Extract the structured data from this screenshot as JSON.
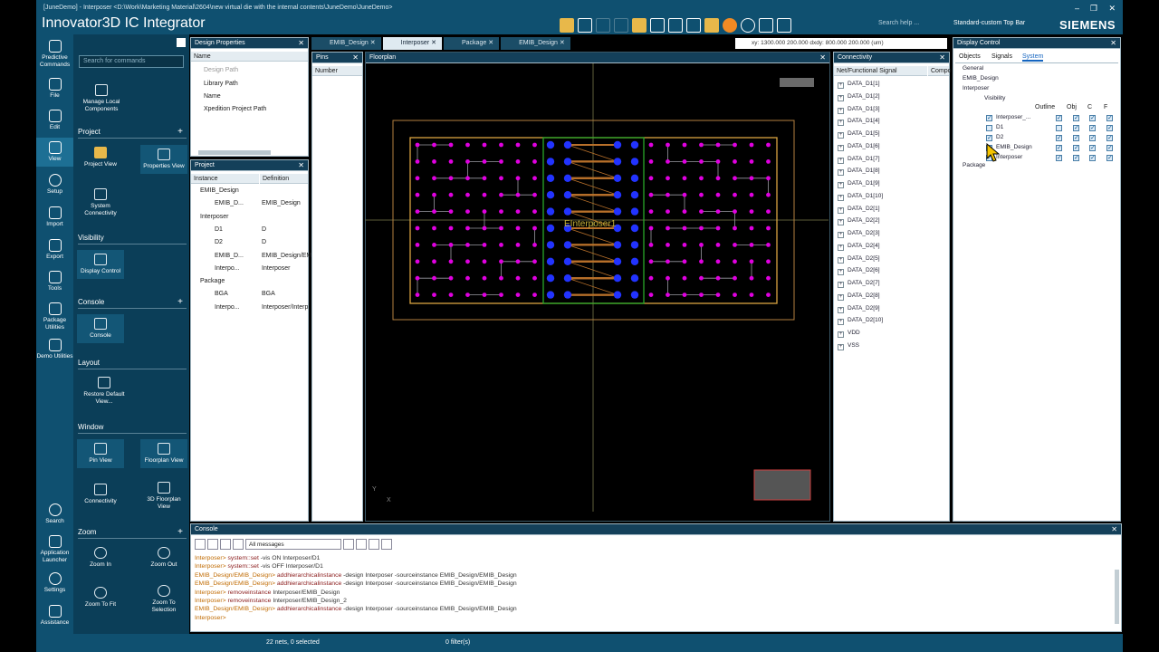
{
  "window": {
    "path": "[JuneDemo] - Interposer <D:\\Work\\Marketing Material\\2604\\new virtual die with the internal contents\\JuneDemo\\JuneDemo>",
    "app_title": "Innovator3D IC Integrator",
    "brand": "SIEMENS",
    "search_placeholder": "Search help ...",
    "topbar_select": "Standard-custom Top Bar",
    "controls": [
      "–",
      "❐",
      "✕"
    ]
  },
  "left_nav": [
    {
      "label": "Predictive Commands",
      "icon": "predictive-icon"
    },
    {
      "label": "File",
      "icon": "file-icon"
    },
    {
      "label": "Edit",
      "icon": "edit-icon"
    },
    {
      "label": "View",
      "icon": "view-icon"
    },
    {
      "label": "Setup",
      "icon": "gear-icon"
    },
    {
      "label": "Import",
      "icon": "import-icon"
    },
    {
      "label": "Export",
      "icon": "export-icon"
    },
    {
      "label": "Tools",
      "icon": "tools-icon"
    },
    {
      "label": "Package Utilities",
      "icon": "package-icon"
    },
    {
      "label": "Demo Utilities",
      "icon": "demo-icon"
    },
    {
      "label": "Search",
      "icon": "search-icon"
    },
    {
      "label": "Application Launcher",
      "icon": "launcher-icon"
    },
    {
      "label": "Settings",
      "icon": "settings-icon"
    },
    {
      "label": "Assistance",
      "icon": "assistance-icon"
    }
  ],
  "tool_panel": {
    "search_placeholder": "Search for commands",
    "manage_local": "Manage Local Components",
    "sections": {
      "project": "Project",
      "visibility": "Visibility",
      "console": "Console",
      "layout": "Layout",
      "window": "Window",
      "zoom": "Zoom"
    },
    "buttons": {
      "project_view": "Project View",
      "properties_view": "Properties View",
      "system_connectivity": "System Connectivity",
      "display_control": "Display Control",
      "console": "Console",
      "restore_default": "Restore Default View...",
      "pin_view": "Pin View",
      "floorplan_view": "Floorplan View",
      "connectivity": "Connectivity",
      "floorplan_3d": "3D Floorplan View",
      "zoom_in": "Zoom In",
      "zoom_out": "Zoom Out",
      "zoom_fit": "Zoom To Fit",
      "zoom_selection": "Zoom To Selection"
    }
  },
  "design_properties": {
    "title": "Design Properties",
    "col_name": "Name",
    "rows": [
      "Design Path",
      "Library Path",
      "Name",
      "Xpedition Project Path"
    ]
  },
  "project_panel": {
    "title": "Project",
    "col_instance": "Instance",
    "col_definition": "Definition",
    "rows": [
      {
        "instance": "EMIB_Design",
        "definition": ""
      },
      {
        "instance": "EMIB_D...",
        "definition": "EMIB_Design"
      },
      {
        "instance": "Interposer",
        "definition": ""
      },
      {
        "instance": "D1",
        "definition": "D"
      },
      {
        "instance": "D2",
        "definition": "D"
      },
      {
        "instance": "EMIB_D...",
        "definition": "EMIB_Design/EM"
      },
      {
        "instance": "Interpo...",
        "definition": "Interposer"
      },
      {
        "instance": "Package",
        "definition": ""
      },
      {
        "instance": "BGA",
        "definition": "BGA"
      },
      {
        "instance": "Interpo...",
        "definition": "Interposer/Interp"
      }
    ]
  },
  "tabs": [
    {
      "label": "EMIB_Design",
      "active": false
    },
    {
      "label": "Interposer",
      "active": true
    },
    {
      "label": "Package",
      "active": false
    },
    {
      "label": "EMIB_Design",
      "active": false
    }
  ],
  "coord_readout": "xy: 1300.000 200.000 dxdy: 800.000 200.000 (um)",
  "pins_panel": {
    "title": "Pins",
    "col": "Number"
  },
  "floorplan": {
    "title": "Floorplan",
    "label": "EInterposer1",
    "axis_y": "Y",
    "axis_x": "X"
  },
  "connectivity": {
    "title": "Connectivity",
    "col_signal": "Net/Functional Signal",
    "col_comp": "Compo",
    "nets": [
      "DATA_D1[1]",
      "DATA_D1[2]",
      "DATA_D1[3]",
      "DATA_D1[4]",
      "DATA_D1[5]",
      "DATA_D1[6]",
      "DATA_D1[7]",
      "DATA_D1[8]",
      "DATA_D1[9]",
      "DATA_D1[10]",
      "DATA_D2[1]",
      "DATA_D2[2]",
      "DATA_D2[3]",
      "DATA_D2[4]",
      "DATA_D2[5]",
      "DATA_D2[6]",
      "DATA_D2[7]",
      "DATA_D2[8]",
      "DATA_D2[9]",
      "DATA_D2[10]",
      "VDD",
      "VSS"
    ]
  },
  "display_control": {
    "title": "Display Control",
    "tabs": [
      "Objects",
      "Signals",
      "System"
    ],
    "cols": [
      "Outline",
      "Obj",
      "C",
      "F"
    ],
    "tree": [
      {
        "label": "General",
        "level": 0
      },
      {
        "label": "EMIB_Design",
        "level": 0
      },
      {
        "label": "Interposer",
        "level": 0
      },
      {
        "label": "Visibility",
        "level": 1
      },
      {
        "label": "Interposer_...",
        "level": 2
      },
      {
        "label": "D1",
        "level": 2
      },
      {
        "label": "D2",
        "level": 2
      },
      {
        "label": "EMIB_Design",
        "level": 2
      },
      {
        "label": "Interposer",
        "level": 2
      },
      {
        "label": "Package",
        "level": 0
      }
    ]
  },
  "console": {
    "title": "Console",
    "filter": "All messages",
    "lines": [
      {
        "prompt": "Interposer>",
        "cmd": "system::set",
        "args": "-vis ON Interposer/D1"
      },
      {
        "prompt": "Interposer>",
        "cmd": "system::set",
        "args": "-vis OFF Interposer/D1"
      },
      {
        "prompt": "EMIB_Design/EMIB_Design>",
        "cmd": "addhierarchicalinstance",
        "args": "-design Interposer -sourceinstance EMIB_Design/EMIB_Design"
      },
      {
        "prompt": "EMIB_Design/EMIB_Design>",
        "cmd": "addhierarchicalinstance",
        "args": "-design Interposer -sourceinstance EMIB_Design/EMIB_Design"
      },
      {
        "prompt": "Interposer>",
        "cmd": "removeinstance",
        "args": "Interposer/EMIB_Design"
      },
      {
        "prompt": "Interposer>",
        "cmd": "removeinstance",
        "args": "Interposer/EMIB_Design_2"
      },
      {
        "prompt": "EMIB_Design/EMIB_Design>",
        "cmd": "addhierarchicalinstance",
        "args": "-design Interposer -sourceinstance EMIB_Design/EMIB_Design"
      },
      {
        "prompt": "Interposer>",
        "cmd": "",
        "args": ""
      }
    ]
  },
  "status": {
    "nets": "22 nets, 0 selected",
    "filters": "0 filter(s)"
  },
  "colors": {
    "chrome": "#0f5070",
    "panel_dark": "#0b3e58",
    "pad": "#e000e0",
    "bump": "#2233ff",
    "outline": "#d9a441",
    "bridge": "#28a828"
  }
}
